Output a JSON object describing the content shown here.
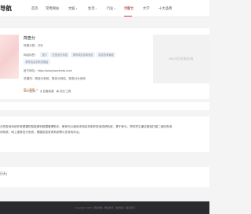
{
  "brand": {
    "logo_text": "导航"
  },
  "nav": [
    {
      "label": "首页",
      "has_caret": false
    },
    {
      "label": "常用网站",
      "has_caret": false
    },
    {
      "label": "文娱",
      "has_caret": true
    },
    {
      "label": "生活",
      "has_caret": true
    },
    {
      "label": "行业",
      "has_caret": true
    },
    {
      "label": "综合",
      "has_caret": false
    },
    {
      "label": "博客",
      "has_caret": false,
      "active": true
    },
    {
      "label": "大学",
      "has_caret": false
    },
    {
      "label": "十大品牌",
      "has_caret": false
    }
  ],
  "site": {
    "name": "简查分",
    "category_label": "所属分类：",
    "category_value": "博客",
    "tags_label": "网站标签：",
    "tags": [
      "查分",
      "在线查分系统",
      "教育成绩查询系统",
      "成绩查询管理",
      "教育信息化系统搭建"
    ],
    "url_label": "官方网址：",
    "url_value": "https://www.jiancfenkv.com/",
    "keywords_label": "关键词：",
    "keywords_value": "简查分官网，简查分网站，简查分分信网",
    "stats_label": "SEO查询：",
    "stat1": "百度权重",
    "stat2": "站长工具",
    "visit_link": "进入官网 ➜"
  },
  "ad": {
    "text": "SEO优化服务商"
  },
  "description": {
    "line1": "分的查询系统非常便捷的智能便利数据管理助手，教师可以使用本网站来制作查询成绩系统，便于家长、学校学生通过微信扫描二维码查询",
    "line2": "询系统、网上报录查分系统，便捷信息查询系统等众多查询平台。"
  },
  "date": {
    "text": "日天)"
  },
  "footer": {
    "text": "Copyright © 2023 · 网站导航 · 网站收录 · 免费收录 · 联系我们"
  }
}
